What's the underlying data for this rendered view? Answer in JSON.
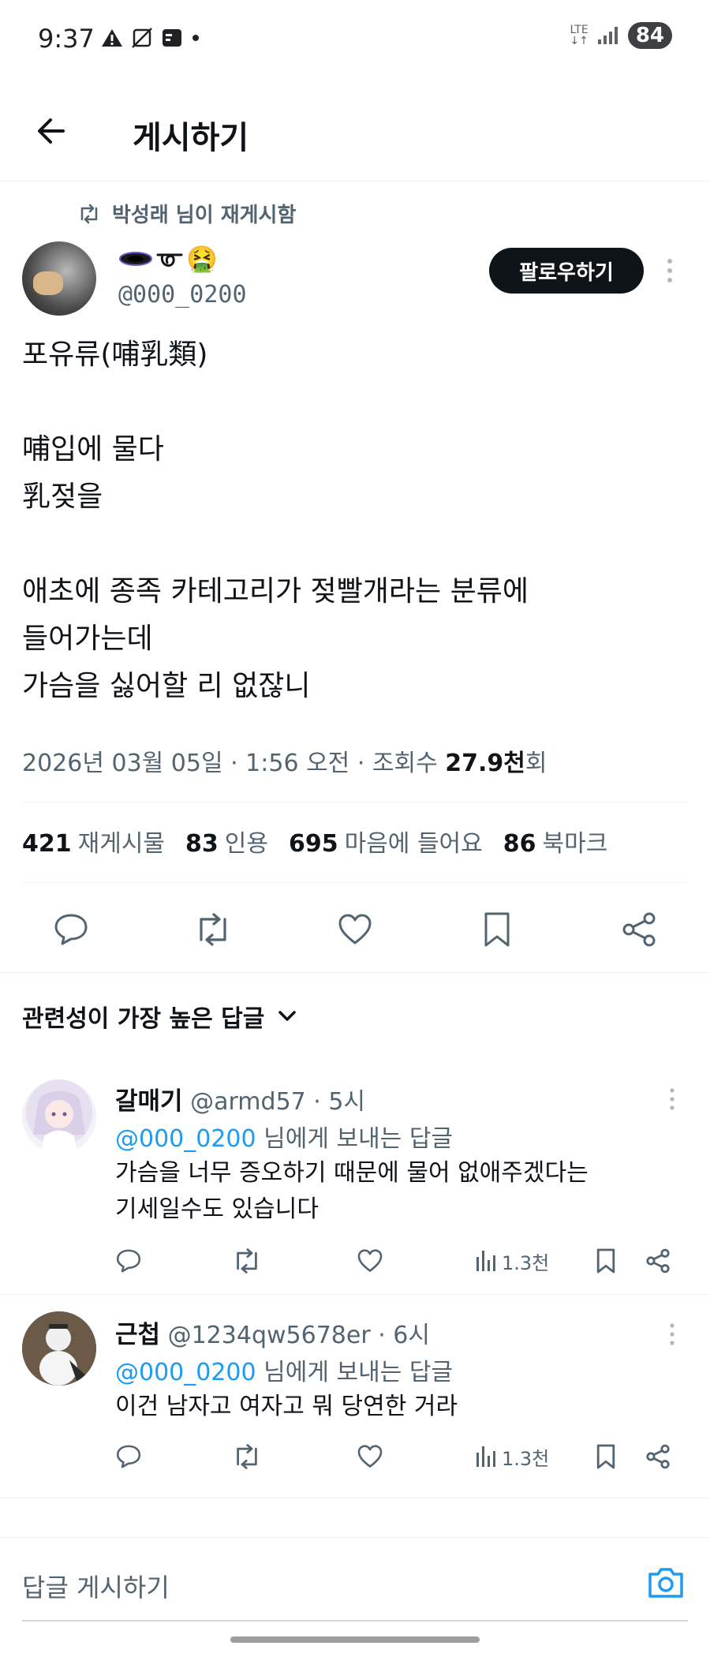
{
  "status_bar": {
    "time": "9:37",
    "network": "LTE",
    "battery": "84"
  },
  "header": {
    "title": "게시하기"
  },
  "post": {
    "repost_text": "박성래 님이 재게시함",
    "author_name_emoji": "🤮",
    "author_handle": "@000_0200",
    "follow_label": "팔로우하기",
    "body": "포유류(哺乳類)\n\n哺입에 물다\n乳젖을\n\n애초에 종족 카테고리가 젖빨개라는 분류에\n들어가는데\n가슴을 싫어할 리 없잖니",
    "meta_prefix": "2026년 03월 05일 · 1:56 오전 · 조회수 ",
    "views": "27.9천",
    "views_suffix": "회"
  },
  "stats": [
    {
      "count": "421",
      "label": "재게시물"
    },
    {
      "count": "83",
      "label": "인용"
    },
    {
      "count": "695",
      "label": "마음에 들어요"
    },
    {
      "count": "86",
      "label": "북마크"
    }
  ],
  "sort_label": "관련성이 가장 높은 답글",
  "replies": [
    {
      "name": "갈매기",
      "handle": "@armd57 · 5시",
      "mention": "@000_0200",
      "to_suffix": " 님에게 보내는 답글",
      "text": "가슴을 너무 증오하기 때문에 물어 없애주겠다는\n기세일수도 있습니다",
      "views": "1.3천"
    },
    {
      "name": "근첩",
      "handle": "@1234qw5678er · 6시",
      "mention": "@000_0200",
      "to_suffix": " 님에게 보내는 답글",
      "text": "이건 남자고 여자고 뭐 당연한 거라",
      "views": "1.3천"
    }
  ],
  "composer": {
    "placeholder": "답글 게시하기"
  },
  "colors": {
    "accent": "#1d9bf0",
    "text": "#0f1419",
    "muted": "#536471"
  }
}
